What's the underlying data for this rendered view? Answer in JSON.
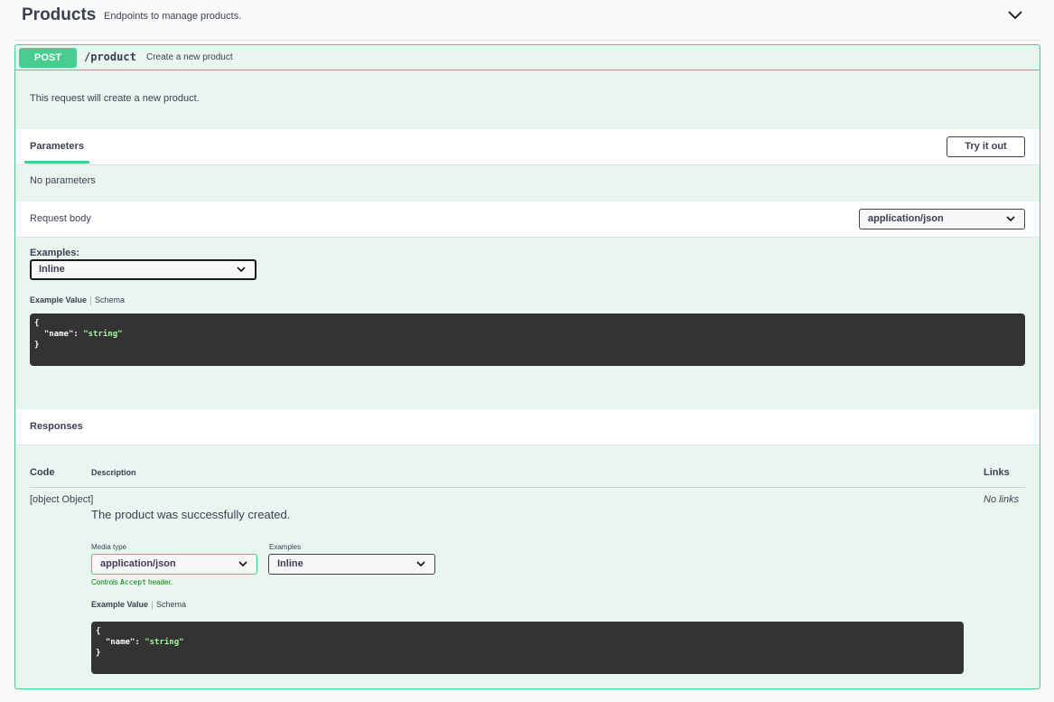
{
  "tag": {
    "title": "Products",
    "description": "Endpoints to manage products.",
    "chevron_icon": "chevron-down-icon"
  },
  "operation": {
    "method": "POST",
    "path": "/product",
    "summary": "Create a new product",
    "description": "This request will create a new product.",
    "accent_color": "#49cc90"
  },
  "parameters": {
    "tab_label": "Parameters",
    "try_button": "Try it out",
    "empty_text": "No parameters"
  },
  "request_body": {
    "label": "Request body",
    "content_type": "application/json",
    "examples_label": "Examples:",
    "examples_selected": "Inline",
    "tab_example_value": "Example Value",
    "tab_schema": "Schema",
    "code": {
      "open": "{",
      "key": "\"name\"",
      "colon": ": ",
      "value": "\"string\"",
      "close": "}"
    }
  },
  "responses": {
    "title": "Responses",
    "columns": {
      "code": "Code",
      "description": "Description",
      "links": "Links"
    },
    "rows": [
      {
        "code": {
          "open": "{",
          "key": "\"name\"",
          "colon": ": ",
          "value": "\"string\"",
          "close": "}"
        },
        "description": "The product was successfully created.",
        "links": "No links",
        "media_type_label": "Media type",
        "media_type_selected": "application/json",
        "examples_label": "Examples",
        "examples_selected": "Inline",
        "controls_note_prefix": "Controls ",
        "controls_note_mono": "Accept",
        "controls_note_suffix": " header.",
        "tab_example_value": "Example Value",
        "tab_schema": "Schema"
      }
    ]
  }
}
